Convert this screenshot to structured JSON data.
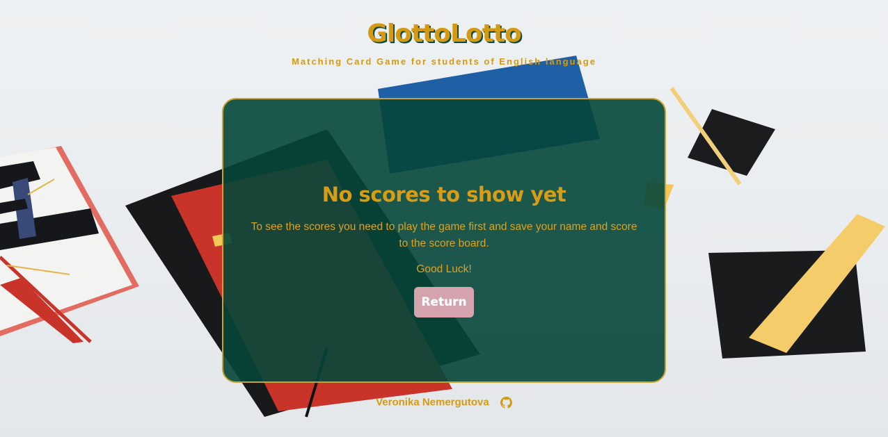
{
  "header": {
    "title": "GlottoLotto",
    "subtitle": "Matching Card Game for students of English language"
  },
  "panel": {
    "heading": "No scores to show yet",
    "message": "To see the scores you need to play the game first and save your name and score to the score board.",
    "luck": "Good Luck!",
    "return_label": "Return"
  },
  "footer": {
    "author": "Veronika Nemergutova",
    "icon": "github-icon"
  },
  "colors": {
    "accent": "#d49a12",
    "panel_bg": "#06463a",
    "panel_border": "#c9a227",
    "button_bg": "#d4a3ad"
  }
}
